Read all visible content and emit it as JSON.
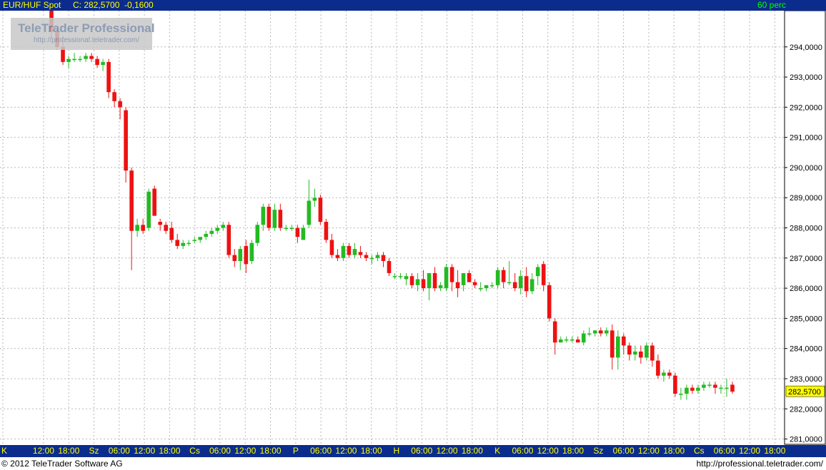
{
  "header": {
    "symbol": "EUR/HUF Spot",
    "close_label": "C: 282,5700",
    "change": "-0,1600",
    "period": "60 perc"
  },
  "logo": {
    "name": "TeleTrader Professional",
    "url": "http://professional.teletrader.com/"
  },
  "footer": {
    "copyright": "© 2012 TeleTrader Software AG",
    "url": "http://professional.teletrader.com/"
  },
  "colors": {
    "up": "#22bb22",
    "down": "#ee1111",
    "bar": "#0b2c8c",
    "text": "#ffff00",
    "period": "#00ff00",
    "marker": "#ffff00",
    "flat": "#00bbcc"
  },
  "chart_data": {
    "type": "candlestick",
    "title": "EUR/HUF Spot",
    "interval": "60 perc",
    "ylim": [
      280.8,
      295.2
    ],
    "y_ticks": [
      "281,0000",
      "282,0000",
      "283,0000",
      "284,0000",
      "285,0000",
      "286,0000",
      "287,0000",
      "288,0000",
      "289,0000",
      "290,0000",
      "291,0000",
      "292,0000",
      "293,0000",
      "294,0000"
    ],
    "y_tick_values": [
      281,
      282,
      283,
      284,
      285,
      286,
      287,
      288,
      289,
      290,
      291,
      292,
      293,
      294
    ],
    "last_price": 282.57,
    "last_price_label": "282,5700",
    "x_labels": [
      "K",
      "12:00",
      "18:00",
      "Sz",
      "06:00",
      "12:00",
      "18:00",
      "Cs",
      "06:00",
      "12:00",
      "18:00",
      "P",
      "06:00",
      "12:00",
      "18:00",
      "H",
      "06:00",
      "12:00",
      "18:00",
      "K",
      "06:00",
      "12:00",
      "18:00",
      "Sz",
      "06:00",
      "12:00",
      "18:00",
      "Cs",
      "06:00",
      "12:00",
      "18:00"
    ],
    "grid": true,
    "candles": [
      [
        295.5,
        295.6,
        294.3,
        294.5
      ],
      [
        294.5,
        294.6,
        293.9,
        294.0
      ],
      [
        294.0,
        294.2,
        293.4,
        293.5
      ],
      [
        293.5,
        293.7,
        293.3,
        293.6
      ],
      [
        293.6,
        293.8,
        293.5,
        293.6
      ],
      [
        293.6,
        293.7,
        293.5,
        293.6
      ],
      [
        293.6,
        293.8,
        293.5,
        293.7
      ],
      [
        293.7,
        293.8,
        293.5,
        293.6
      ],
      [
        293.6,
        293.7,
        293.3,
        293.4
      ],
      [
        293.4,
        293.6,
        293.2,
        293.5
      ],
      [
        293.5,
        293.6,
        292.3,
        292.5
      ],
      [
        292.5,
        292.6,
        292.0,
        292.2
      ],
      [
        292.2,
        292.3,
        291.6,
        292.0
      ],
      [
        291.9,
        292.0,
        289.5,
        289.9
      ],
      [
        289.9,
        290.0,
        286.6,
        287.9
      ],
      [
        287.9,
        288.3,
        287.7,
        288.1
      ],
      [
        288.1,
        288.3,
        287.8,
        287.9
      ],
      [
        288.0,
        289.3,
        287.9,
        289.2
      ],
      [
        289.3,
        289.4,
        288.4,
        288.4
      ],
      [
        288.2,
        288.3,
        287.9,
        288.1
      ],
      [
        288.1,
        288.2,
        287.8,
        287.9
      ],
      [
        288.0,
        288.2,
        287.5,
        287.6
      ],
      [
        287.6,
        287.8,
        287.3,
        287.4
      ],
      [
        287.4,
        287.6,
        287.3,
        287.5
      ],
      [
        287.5,
        287.6,
        287.4,
        287.5
      ],
      [
        287.6,
        287.7,
        287.5,
        287.6
      ],
      [
        287.6,
        287.7,
        287.5,
        287.7
      ],
      [
        287.7,
        287.9,
        287.6,
        287.8
      ],
      [
        287.8,
        288.0,
        287.7,
        287.9
      ],
      [
        287.9,
        288.1,
        287.8,
        288.0
      ],
      [
        288.0,
        288.2,
        287.9,
        288.1
      ],
      [
        288.1,
        288.2,
        287.0,
        287.1
      ],
      [
        287.1,
        287.3,
        286.7,
        286.9
      ],
      [
        286.9,
        287.4,
        286.6,
        287.3
      ],
      [
        287.4,
        287.6,
        286.5,
        286.8
      ],
      [
        286.9,
        287.6,
        286.8,
        287.5
      ],
      [
        287.5,
        288.2,
        287.4,
        288.1
      ],
      [
        288.1,
        288.8,
        287.9,
        288.7
      ],
      [
        288.7,
        288.8,
        287.9,
        288.0
      ],
      [
        288.0,
        288.8,
        287.9,
        288.6
      ],
      [
        288.6,
        288.8,
        287.9,
        288.0
      ],
      [
        288.0,
        288.1,
        287.9,
        288.0
      ],
      [
        288.0,
        288.1,
        287.9,
        288.0
      ],
      [
        288.0,
        288.1,
        287.5,
        287.7
      ],
      [
        287.6,
        288.1,
        287.6,
        288.0
      ],
      [
        288.1,
        289.6,
        288.0,
        288.9
      ],
      [
        288.9,
        289.3,
        288.7,
        289.0
      ],
      [
        289.0,
        289.1,
        288.1,
        288.2
      ],
      [
        288.2,
        288.3,
        287.5,
        287.6
      ],
      [
        287.6,
        287.8,
        287.0,
        287.1
      ],
      [
        287.1,
        287.3,
        286.9,
        287.0
      ],
      [
        287.0,
        287.5,
        286.9,
        287.4
      ],
      [
        287.4,
        287.5,
        287.0,
        287.1
      ],
      [
        287.1,
        287.5,
        287.0,
        287.3
      ],
      [
        287.2,
        287.4,
        287.0,
        287.1
      ],
      [
        287.1,
        287.2,
        286.9,
        287.0
      ],
      [
        287.0,
        287.1,
        286.8,
        287.0
      ],
      [
        287.0,
        287.2,
        286.9,
        287.1
      ],
      [
        287.1,
        287.2,
        286.7,
        286.9
      ],
      [
        286.9,
        287.0,
        286.4,
        286.5
      ],
      [
        286.4,
        286.5,
        286.3,
        286.4
      ],
      [
        286.4,
        286.5,
        286.3,
        286.4
      ],
      [
        286.3,
        286.5,
        286.1,
        286.4
      ],
      [
        286.4,
        286.5,
        286.0,
        286.1
      ],
      [
        286.1,
        286.5,
        285.9,
        286.3
      ],
      [
        286.3,
        286.6,
        285.9,
        286.0
      ],
      [
        286.0,
        286.5,
        285.6,
        286.5
      ],
      [
        286.5,
        286.7,
        285.9,
        286.0
      ],
      [
        286.0,
        286.2,
        285.9,
        286.1
      ],
      [
        286.0,
        286.8,
        285.9,
        286.7
      ],
      [
        286.7,
        286.8,
        285.9,
        286.2
      ],
      [
        286.2,
        286.6,
        285.7,
        286.0
      ],
      [
        286.1,
        286.5,
        285.9,
        286.5
      ],
      [
        286.5,
        286.6,
        286.2,
        286.2
      ],
      [
        286.2,
        286.3,
        286.0,
        286.1
      ],
      [
        286.0,
        286.2,
        285.9,
        286.0
      ],
      [
        286.0,
        286.1,
        285.9,
        286.1
      ],
      [
        286.1,
        286.2,
        286.0,
        286.1
      ],
      [
        286.1,
        286.7,
        286.0,
        286.6
      ],
      [
        286.6,
        286.7,
        286.0,
        286.2
      ],
      [
        286.2,
        286.9,
        286.1,
        286.2
      ],
      [
        286.2,
        286.5,
        285.9,
        286.0
      ],
      [
        286.0,
        286.6,
        285.8,
        286.4
      ],
      [
        286.4,
        286.7,
        285.7,
        285.9
      ],
      [
        285.9,
        286.5,
        285.8,
        286.3
      ],
      [
        286.4,
        286.8,
        286.1,
        286.7
      ],
      [
        286.8,
        286.9,
        285.9,
        286.1
      ],
      [
        286.1,
        286.2,
        284.9,
        285.0
      ],
      [
        284.9,
        285.0,
        283.8,
        284.2
      ],
      [
        284.2,
        284.4,
        284.2,
        284.3
      ],
      [
        284.3,
        284.4,
        284.2,
        284.3
      ],
      [
        284.3,
        284.4,
        284.2,
        284.3
      ],
      [
        284.3,
        284.4,
        284.2,
        284.2
      ],
      [
        284.2,
        284.6,
        284.1,
        284.5
      ],
      [
        284.5,
        284.7,
        284.4,
        284.5
      ],
      [
        284.5,
        284.6,
        284.4,
        284.6
      ],
      [
        284.6,
        284.7,
        284.4,
        284.5
      ],
      [
        284.5,
        284.7,
        284.4,
        284.6
      ],
      [
        284.6,
        284.8,
        283.3,
        283.7
      ],
      [
        283.7,
        284.6,
        283.3,
        284.4
      ],
      [
        284.4,
        284.5,
        283.8,
        284.1
      ],
      [
        284.1,
        284.2,
        283.6,
        283.8
      ],
      [
        283.8,
        284.1,
        283.6,
        283.9
      ],
      [
        283.9,
        284.1,
        283.5,
        283.7
      ],
      [
        283.7,
        284.2,
        283.6,
        284.1
      ],
      [
        284.1,
        284.2,
        283.4,
        283.6
      ],
      [
        283.6,
        283.8,
        283.0,
        283.1
      ],
      [
        283.1,
        283.3,
        282.9,
        283.2
      ],
      [
        283.2,
        283.3,
        283.0,
        283.1
      ],
      [
        283.1,
        283.2,
        282.4,
        282.5
      ],
      [
        282.5,
        282.7,
        282.3,
        282.5
      ],
      [
        282.5,
        282.8,
        282.3,
        282.7
      ],
      [
        282.7,
        282.8,
        282.5,
        282.6
      ],
      [
        282.6,
        282.8,
        282.5,
        282.7
      ],
      [
        282.7,
        282.9,
        282.6,
        282.8
      ],
      [
        282.8,
        282.9,
        282.7,
        282.8
      ],
      [
        282.8,
        282.9,
        282.5,
        282.7
      ],
      [
        282.7,
        282.8,
        282.5,
        282.7
      ],
      [
        282.7,
        283.0,
        282.4,
        282.7
      ],
      [
        282.8,
        282.9,
        282.5,
        282.57
      ]
    ]
  }
}
